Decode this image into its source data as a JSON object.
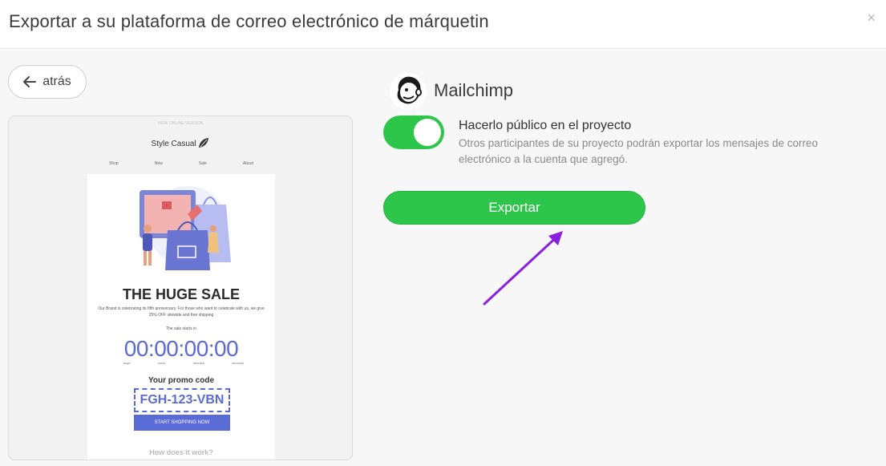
{
  "header": {
    "title": "Exportar a su plataforma de correo electrónico de márquetin",
    "close_symbol": "×"
  },
  "back_button": {
    "label": "atrás",
    "icon": "arrow-left-icon"
  },
  "preview": {
    "top_text": "VIEW ONLINE VERSION",
    "brand": "Style Casual",
    "nav": [
      "Shop",
      "New",
      "Sale",
      "About"
    ],
    "headline": "THE HUGE SALE",
    "description": "Our Brand is celebrating its fifth anniversary. For those who want to celebrate with us, we give 25% OFF sitewide and free shipping",
    "starts": "The sale starts in",
    "timer": "00:00:00:00",
    "units": [
      "days",
      "hours",
      "minutes",
      "seconds"
    ],
    "promo_label": "Your promo code",
    "promo_code": "FGH-123-VBN",
    "shop_button": "START SHOPPING NOW",
    "how": "How does it work?"
  },
  "provider": {
    "name": "Mailchimp",
    "icon": "mailchimp-logo"
  },
  "toggle": {
    "label": "Hacerlo público en el proyecto",
    "description": "Otros participantes de su proyecto podrán exportar los mensajes de correo electrónico a la cuenta que agregó.",
    "checked": true
  },
  "export_button": {
    "label": "Exportar"
  },
  "colors": {
    "accent_green": "#2ec54b",
    "annotation_purple": "#8a1fe0",
    "promo_blue": "#5b6bd6"
  }
}
